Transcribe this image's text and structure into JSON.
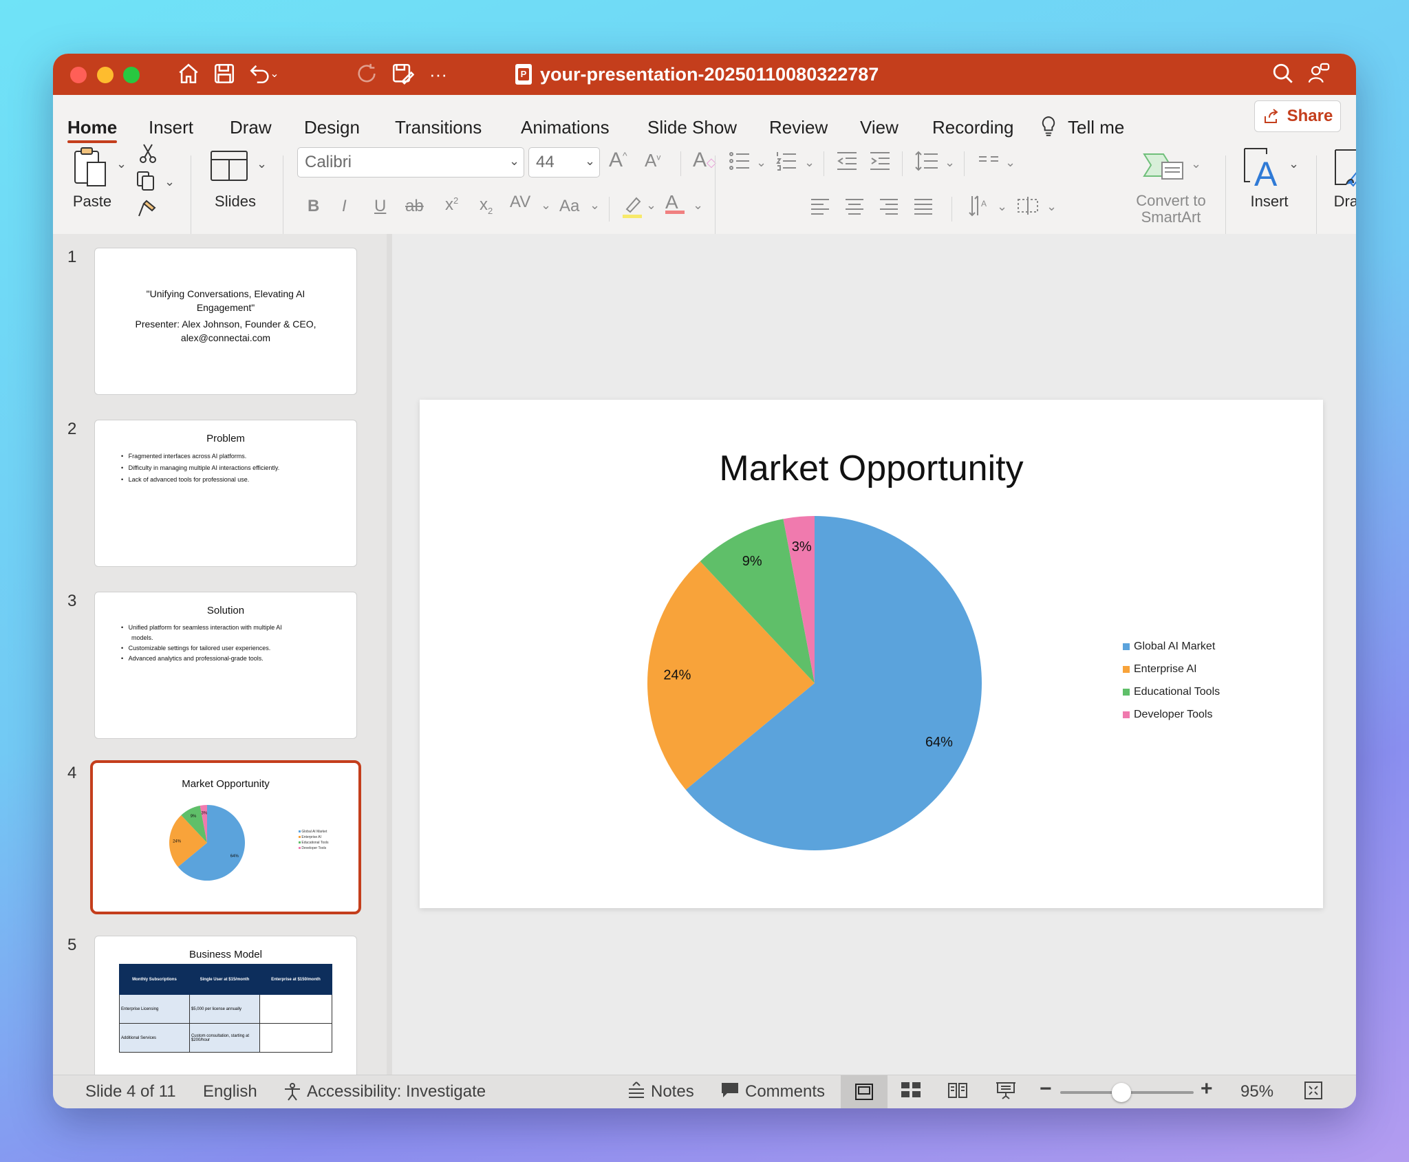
{
  "window": {
    "title": "your-presentation-20250110080322787",
    "traffic_colors": [
      "#ff5f57",
      "#febc2e",
      "#28c840"
    ]
  },
  "tabs": [
    "Home",
    "Insert",
    "Draw",
    "Design",
    "Transitions",
    "Animations",
    "Slide Show",
    "Review",
    "View",
    "Recording"
  ],
  "active_tab": "Home",
  "tell_me": "Tell me",
  "share_label": "Share",
  "ribbon": {
    "paste": "Paste",
    "slides": "Slides",
    "font_name": "Calibri",
    "font_size": "44",
    "convert_smartart_line1": "Convert to",
    "convert_smartart_line2": "SmartArt",
    "insert": "Insert",
    "drawing": "Drawing"
  },
  "thumbnails": {
    "s1": {
      "num": "1",
      "line1": "\"Unifying Conversations, Elevating AI",
      "line2": "Engagement\"",
      "line3": "Presenter: Alex Johnson, Founder & CEO,",
      "line4": "alex@connectai.com"
    },
    "s2": {
      "num": "2",
      "title": "Problem",
      "bullets": [
        "Fragmented interfaces across AI platforms.",
        "Difficulty in managing multiple AI interactions efficiently.",
        "Lack of advanced tools for professional use."
      ]
    },
    "s3": {
      "num": "3",
      "title": "Solution",
      "bullets": [
        "Unified platform for seamless interaction with multiple AI",
        "models.",
        "Customizable settings for tailored user experiences.",
        "Advanced analytics and professional-grade tools."
      ]
    },
    "s4": {
      "num": "4",
      "title": "Market Opportunity",
      "legend": [
        "Global AI Market",
        "Enterprise AI",
        "Educational Tools",
        "Developer Tools"
      ],
      "labels": [
        "64%",
        "24%",
        "9%",
        "3%"
      ]
    },
    "s5": {
      "num": "5",
      "title": "Business Model",
      "table_header": [
        "Monthly Subscriptions",
        "Single User at $15/month",
        "Enterprise at $150/month"
      ],
      "row1": [
        "Enterprise Licensing",
        "$5,000 per license annually",
        ""
      ],
      "row2": [
        "Additional Services",
        "Custom consultation, starting at $200/hour",
        ""
      ]
    }
  },
  "slide": {
    "title": "Market Opportunity"
  },
  "chart_data": {
    "type": "pie",
    "title": "Market Opportunity",
    "categories": [
      "Global AI Market",
      "Enterprise AI",
      "Educational Tools",
      "Developer Tools"
    ],
    "values": [
      64,
      24,
      9,
      3
    ],
    "data_labels": [
      "64%",
      "24%",
      "9%",
      "3%"
    ],
    "colors": [
      "#5ba3dc",
      "#f8a33a",
      "#5fbf69",
      "#f07aae"
    ],
    "legend_position": "right"
  },
  "status": {
    "slide_of": "Slide 4 of 11",
    "language": "English",
    "accessibility": "Accessibility: Investigate",
    "notes": "Notes",
    "comments": "Comments",
    "zoom": "95%"
  }
}
